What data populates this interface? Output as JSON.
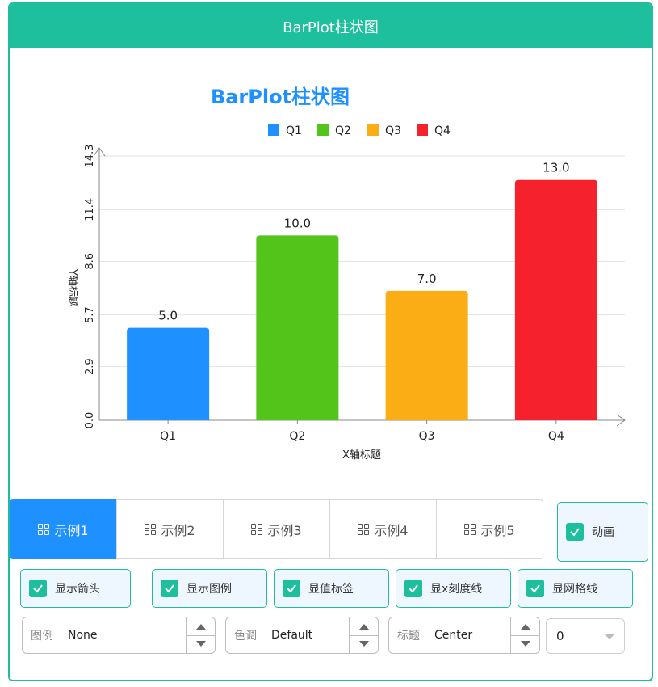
{
  "window": {
    "title": "BarPlot柱状图"
  },
  "chart_data": {
    "type": "bar",
    "title": "BarPlot柱状图",
    "xlabel": "X轴标题",
    "ylabel": "Y轴标题",
    "categories": [
      "Q1",
      "Q2",
      "Q3",
      "Q4"
    ],
    "values": [
      5.0,
      10.0,
      7.0,
      13.0
    ],
    "value_labels": [
      "5.0",
      "10.0",
      "7.0",
      "13.0"
    ],
    "colors": [
      "#1e90ff",
      "#52c41a",
      "#faad14",
      "#f5222d"
    ],
    "ylim": [
      0,
      14.3
    ],
    "yticks": [
      0.0,
      2.9,
      5.7,
      8.6,
      11.4,
      14.3
    ],
    "ytick_labels": [
      "0.0",
      "2.9",
      "5.7",
      "8.6",
      "11.4",
      "14.3"
    ],
    "legend": [
      "Q1",
      "Q2",
      "Q3",
      "Q4"
    ],
    "legend_position": "top-center",
    "grid": true
  },
  "tabs": [
    {
      "label": "示例1",
      "active": true
    },
    {
      "label": "示例2",
      "active": false
    },
    {
      "label": "示例3",
      "active": false
    },
    {
      "label": "示例4",
      "active": false
    },
    {
      "label": "示例5",
      "active": false
    }
  ],
  "options": {
    "animation": "动画",
    "show_arrow": "显示箭头",
    "show_legend": "显示图例",
    "show_value_label": "显值标签",
    "show_x_ticks": "显x刻度线",
    "show_grid": "显网格线"
  },
  "controls": {
    "legend": {
      "label": "图例",
      "value": "None"
    },
    "color": {
      "label": "色调",
      "value": "Default"
    },
    "title": {
      "label": "标题",
      "value": "Center"
    },
    "combo_value": "0"
  },
  "accent": "#1dbf9c"
}
